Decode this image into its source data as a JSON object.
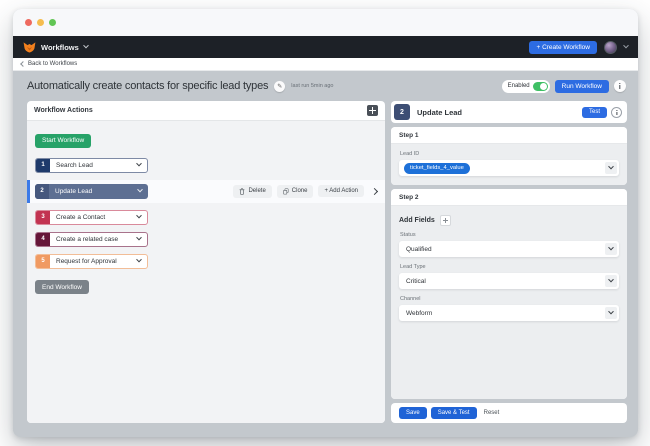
{
  "colors": {
    "accent_blue": "#2d6ce2",
    "token_blue": "#1d70d8",
    "toggle_green": "#3fc065",
    "start_green": "#27a268",
    "end_gray": "#7b8289",
    "navbar_bg": "#1d2127",
    "workspace_gray": "#c3c8cd",
    "step1_badge": "#1e3a6b",
    "step2_row": "#5d6f92",
    "step3_badge": "#c23351",
    "step4_badge": "#651638",
    "step5_badge": "#f09a62"
  },
  "icons": {
    "pencil": "✎"
  },
  "navbar": {
    "product": "Workflows",
    "create_button": "+ Create Workflow"
  },
  "breadcrumb": {
    "back": "Back to Workflows"
  },
  "header": {
    "title": "Automatically create contacts for specific lead types",
    "last_run": "last run 5min ago",
    "enabled": "Enabled",
    "run_button": "Run Workflow"
  },
  "left_panel": {
    "title": "Workflow Actions",
    "start_button": "Start Workflow",
    "end_button": "End Workflow",
    "steps": [
      {
        "num": "1",
        "label": "Search Lead"
      },
      {
        "num": "2",
        "label": "Update Lead"
      },
      {
        "num": "3",
        "label": "Create a Contact"
      },
      {
        "num": "4",
        "label": "Create a related case"
      },
      {
        "num": "5",
        "label": "Request for Approval"
      }
    ],
    "actions": {
      "delete": "Delete",
      "clone": "Clone",
      "add": "+ Add Action"
    }
  },
  "right_panel": {
    "step_num": "2",
    "title": "Update Lead",
    "test_button": "Test",
    "step1": {
      "title": "Step 1",
      "field_label": "Lead ID",
      "token": "ticket_fields_4_value"
    },
    "step2": {
      "title": "Step 2",
      "add_fields": "Add Fields",
      "fields": [
        {
          "label": "Status",
          "value": "Qualified"
        },
        {
          "label": "Lead Type",
          "value": "Critical"
        },
        {
          "label": "Channel",
          "value": "Webform"
        }
      ]
    },
    "footer": {
      "save": "Save",
      "save_test": "Save & Test",
      "reset": "Reset"
    }
  }
}
